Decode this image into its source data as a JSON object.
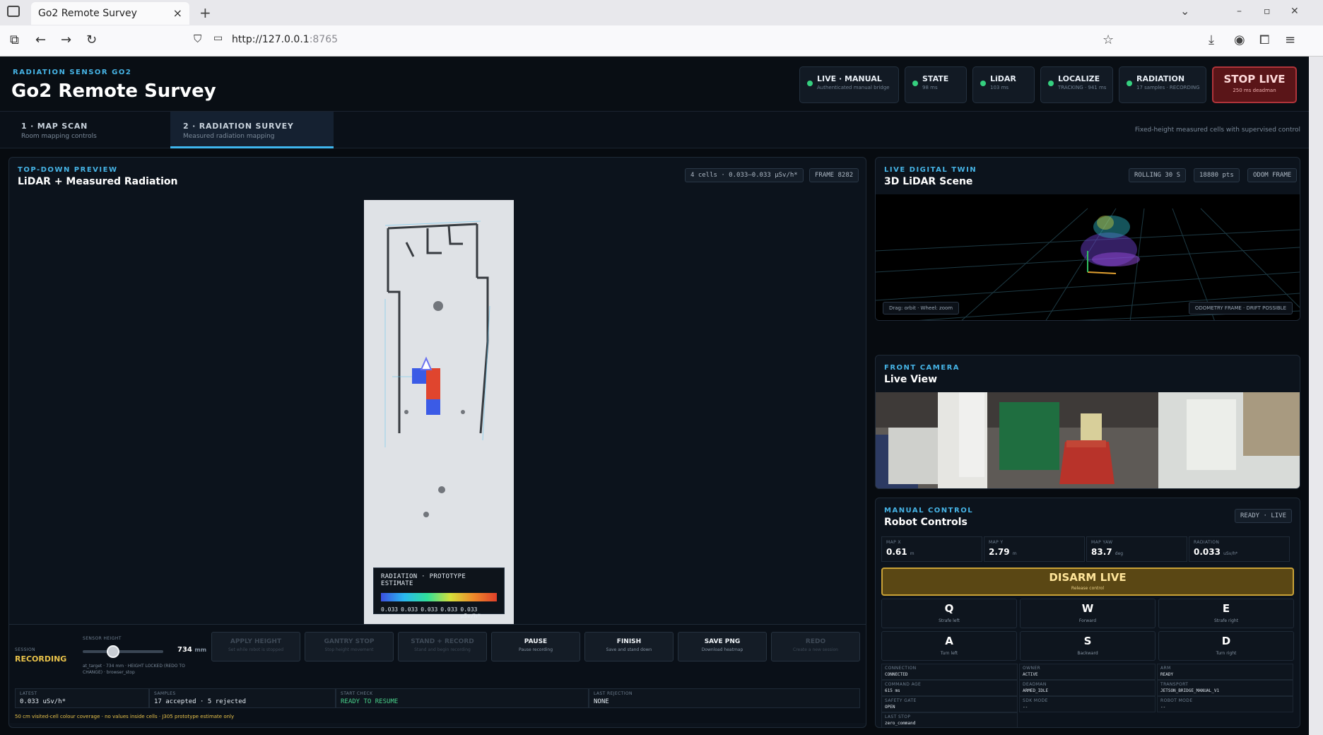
{
  "browser": {
    "tab_title": "Go2 Remote Survey",
    "tab_close": "×",
    "new_tab": "+",
    "url_host": "http://127.0.0.1",
    "url_port": ":8765"
  },
  "header": {
    "kicker": "RADIATION SENSOR GO2",
    "title": "Go2 Remote Survey",
    "pills": [
      {
        "title": "LIVE · MANUAL",
        "sub": "Authenticated manual bridge"
      },
      {
        "title": "STATE",
        "sub": "98 ms"
      },
      {
        "title": "LiDAR",
        "sub": "103 ms"
      },
      {
        "title": "LOCALIZE",
        "sub": "TRACKING · 941 ms"
      },
      {
        "title": "RADIATION",
        "sub": "17 samples · RECORDING"
      }
    ],
    "stop": {
      "title": "STOP LIVE",
      "sub": "250 ms deadman"
    }
  },
  "tabs": [
    {
      "title": "1 · MAP SCAN",
      "sub": "Room mapping controls"
    },
    {
      "title": "2 · RADIATION SURVEY",
      "sub": "Measured radiation mapping"
    }
  ],
  "tab_note": "Fixed-height measured cells with supervised control",
  "preview": {
    "kicker": "TOP-DOWN PREVIEW",
    "title": "LiDAR + Measured Radiation",
    "chip_cells": "4 cells · 0.033–0.033 µSv/h*",
    "chip_frame": "FRAME 8282",
    "legend_title": "RADIATION · PROTOTYPE ESTIMATE",
    "legend_values": [
      "0.033",
      "0.033",
      "0.033",
      "0.033",
      "0.033 µSv/h*"
    ]
  },
  "controls": {
    "session_label": "SESSION",
    "session_value": "RECORDING",
    "height_label": "SENSOR HEIGHT",
    "height_value": "734",
    "height_unit": "mm",
    "height_fraction": 0.38,
    "height_note": "at_target · 734 mm · HEIGHT LOCKED (REDO TO CHANGE) · browser_stop",
    "buttons": [
      {
        "title": "APPLY HEIGHT",
        "sub": "Set while robot is stopped"
      },
      {
        "title": "GANTRY STOP",
        "sub": "Stop height movement"
      },
      {
        "title": "STAND + RECORD",
        "sub": "Stand and begin recording"
      },
      {
        "title": "PAUSE",
        "sub": "Pause recording"
      },
      {
        "title": "FINISH",
        "sub": "Save and stand down"
      },
      {
        "title": "SAVE PNG",
        "sub": "Download heatmap"
      },
      {
        "title": "REDO",
        "sub": "Create a new session"
      }
    ],
    "stats": [
      {
        "label": "LATEST",
        "value": "0.033 uSv/h*"
      },
      {
        "label": "SAMPLES",
        "value": "17 accepted · 5 rejected"
      },
      {
        "label": "START CHECK",
        "value": "READY TO RESUME"
      },
      {
        "label": "LAST REJECTION",
        "value": "NONE"
      }
    ],
    "footnote": "50 cm visited-cell colour coverage · no values inside cells · J305 prototype estimate only"
  },
  "twin": {
    "kicker": "LIVE DIGITAL TWIN",
    "title": "3D LiDAR Scene",
    "chips": [
      "ROLLING 30 S",
      "18880 pts",
      "ODOM FRAME"
    ],
    "hint": "Drag: orbit · Wheel: zoom",
    "frame_note": "ODOMETRY FRAME · DRIFT POSSIBLE"
  },
  "camera": {
    "kicker": "FRONT CAMERA",
    "title": "Live View"
  },
  "robot": {
    "kicker": "MANUAL CONTROL",
    "title": "Robot Controls",
    "status_chip": "READY · LIVE",
    "metrics": [
      {
        "label": "MAP X",
        "value": "0.61",
        "unit": "m"
      },
      {
        "label": "MAP Y",
        "value": "2.79",
        "unit": "m"
      },
      {
        "label": "MAP YAW",
        "value": "83.7",
        "unit": "deg"
      },
      {
        "label": "RADIATION",
        "value": "0.033",
        "unit": "uSv/h*"
      }
    ],
    "disarm": {
      "title": "DISARM LIVE",
      "sub": "Release control"
    },
    "keys": [
      {
        "key": "Q",
        "sub": "Strafe left"
      },
      {
        "key": "W",
        "sub": "Forward"
      },
      {
        "key": "E",
        "sub": "Strafe right"
      },
      {
        "key": "A",
        "sub": "Turn left"
      },
      {
        "key": "S",
        "sub": "Backward"
      },
      {
        "key": "D",
        "sub": "Turn right"
      }
    ],
    "info": [
      {
        "label": "CONNECTION",
        "value": "CONNECTED"
      },
      {
        "label": "OWNER",
        "value": "ACTIVE"
      },
      {
        "label": "ARM",
        "value": "READY"
      },
      {
        "label": "COMMAND AGE",
        "value": "615 ms"
      },
      {
        "label": "DEADMAN",
        "value": "ARMED_IDLE"
      },
      {
        "label": "TRANSPORT",
        "value": "JETSON_BRIDGE_MANUAL_V1"
      },
      {
        "label": "SAFETY GATE",
        "value": "OPEN"
      },
      {
        "label": "SDK MODE",
        "value": "--"
      },
      {
        "label": "ROBOT MODE",
        "value": "--"
      },
      {
        "label": "LAST STOP",
        "value": "zero_command"
      }
    ]
  }
}
